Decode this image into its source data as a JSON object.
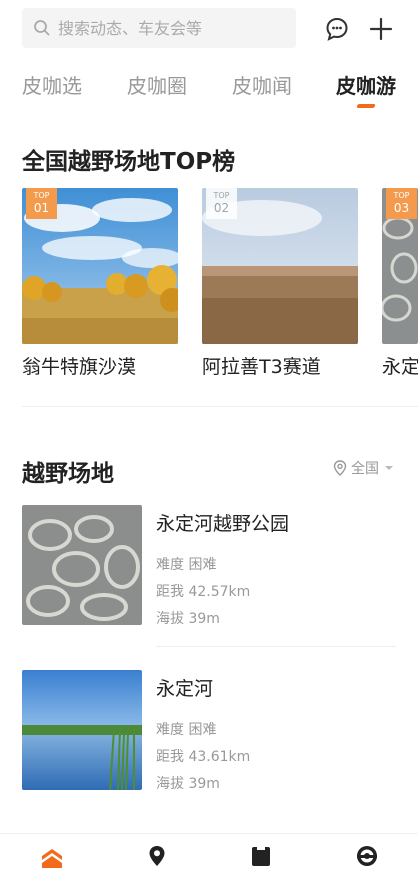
{
  "search": {
    "placeholder": "搜索动态、车友会等"
  },
  "header_icons": [
    "message-icon",
    "plus-icon"
  ],
  "tabs": [
    {
      "label": "皮咖选",
      "active": false
    },
    {
      "label": "皮咖圈",
      "active": false
    },
    {
      "label": "皮咖闻",
      "active": false
    },
    {
      "label": "皮咖游",
      "active": true
    }
  ],
  "top_section": {
    "title": "全国越野场地TOP榜",
    "cards": [
      {
        "badge_label": "TOP",
        "rank": "01",
        "name": "翁牛特旗沙漠"
      },
      {
        "badge_label": "TOP",
        "rank": "02",
        "name": "阿拉善T3赛道"
      },
      {
        "badge_label": "TOP",
        "rank": "03",
        "name": "永定"
      }
    ]
  },
  "sites_section": {
    "title": "越野场地",
    "region_filter": "全国",
    "items": [
      {
        "title": "永定河越野公园",
        "difficulty": "难度 困难",
        "distance": "距我 42.57km",
        "altitude": "海拔 39m"
      },
      {
        "title": "永定河",
        "difficulty": "难度 困难",
        "distance": "距我 43.61km",
        "altitude": "海拔 39m"
      }
    ]
  },
  "bottom_nav": [
    "home-icon",
    "location-icon",
    "bookmark-icon",
    "steering-wheel-icon"
  ],
  "colors": {
    "accent": "#f26a1b",
    "badge": "#f39a4c",
    "muted_text": "#999999"
  }
}
